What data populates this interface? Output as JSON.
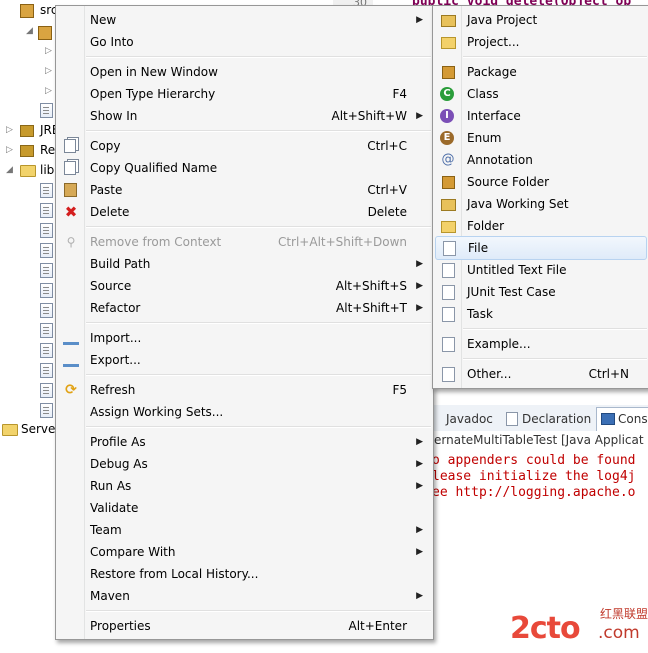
{
  "tree": {
    "items": [
      {
        "label": "src"
      },
      {
        "label": "JRE"
      },
      {
        "label": "Re"
      },
      {
        "label": "lib"
      },
      {
        "label": "Server"
      }
    ]
  },
  "editor": {
    "line_number": "30",
    "code": "public void delete(Object ob"
  },
  "bottom_panel": {
    "tabs": [
      {
        "label": "Javadoc"
      },
      {
        "label": "Declaration"
      },
      {
        "label": "Cons"
      }
    ],
    "console_title": "ernateMultiTableTest [Java Applicat",
    "lines": [
      "o appenders could be found",
      "lease initialize the log4j",
      "ee http://logging.apache.o"
    ]
  },
  "context_menu": {
    "items": [
      {
        "label": "New",
        "accel": "",
        "submenu": true
      },
      {
        "label": "Go Into",
        "accel": ""
      },
      {
        "label": "Open in New Window",
        "accel": ""
      },
      {
        "label": "Open Type Hierarchy",
        "accel": "F4"
      },
      {
        "label": "Show In",
        "accel": "Alt+Shift+W",
        "submenu": true
      },
      {
        "label": "Copy",
        "accel": "Ctrl+C",
        "icon": "copy-icon"
      },
      {
        "label": "Copy Qualified Name",
        "accel": "",
        "icon": "copy-qualified-icon"
      },
      {
        "label": "Paste",
        "accel": "Ctrl+V",
        "icon": "paste-icon"
      },
      {
        "label": "Delete",
        "accel": "Delete",
        "icon": "delete-icon"
      },
      {
        "label": "Remove from Context",
        "accel": "Ctrl+Alt+Shift+Down",
        "disabled": true,
        "icon": "remove-context-icon"
      },
      {
        "label": "Build Path",
        "accel": "",
        "submenu": true
      },
      {
        "label": "Source",
        "accel": "Alt+Shift+S",
        "submenu": true
      },
      {
        "label": "Refactor",
        "accel": "Alt+Shift+T",
        "submenu": true
      },
      {
        "label": "Import...",
        "accel": "",
        "icon": "import-icon"
      },
      {
        "label": "Export...",
        "accel": "",
        "icon": "export-icon"
      },
      {
        "label": "Refresh",
        "accel": "F5",
        "icon": "refresh-icon"
      },
      {
        "label": "Assign Working Sets...",
        "accel": ""
      },
      {
        "label": "Profile As",
        "accel": "",
        "submenu": true
      },
      {
        "label": "Debug As",
        "accel": "",
        "submenu": true
      },
      {
        "label": "Run As",
        "accel": "",
        "submenu": true
      },
      {
        "label": "Validate",
        "accel": ""
      },
      {
        "label": "Team",
        "accel": "",
        "submenu": true
      },
      {
        "label": "Compare With",
        "accel": "",
        "submenu": true
      },
      {
        "label": "Restore from Local History...",
        "accel": ""
      },
      {
        "label": "Maven",
        "accel": "",
        "submenu": true
      },
      {
        "label": "Properties",
        "accel": "Alt+Enter"
      }
    ]
  },
  "new_submenu": {
    "items": [
      {
        "label": "Java Project",
        "accel": ""
      },
      {
        "label": "Project...",
        "accel": ""
      },
      {
        "label": "Package",
        "accel": ""
      },
      {
        "label": "Class",
        "accel": ""
      },
      {
        "label": "Interface",
        "accel": ""
      },
      {
        "label": "Enum",
        "accel": ""
      },
      {
        "label": "Annotation",
        "accel": ""
      },
      {
        "label": "Source Folder",
        "accel": ""
      },
      {
        "label": "Java Working Set",
        "accel": ""
      },
      {
        "label": "Folder",
        "accel": ""
      },
      {
        "label": "File",
        "accel": "",
        "highlighted": true
      },
      {
        "label": "Untitled Text File",
        "accel": ""
      },
      {
        "label": "JUnit Test Case",
        "accel": ""
      },
      {
        "label": "Task",
        "accel": ""
      },
      {
        "label": "Example...",
        "accel": ""
      },
      {
        "label": "Other...",
        "accel": "Ctrl+N"
      }
    ]
  },
  "watermark": {
    "text": "2cto",
    "suffix": ".com",
    "brand": "红黑联盟"
  },
  "colors": {
    "console_error": "#c00000",
    "keyword": "#7f0055",
    "menu_bg": "#f5f5f5",
    "highlight": "#dfebf9"
  }
}
